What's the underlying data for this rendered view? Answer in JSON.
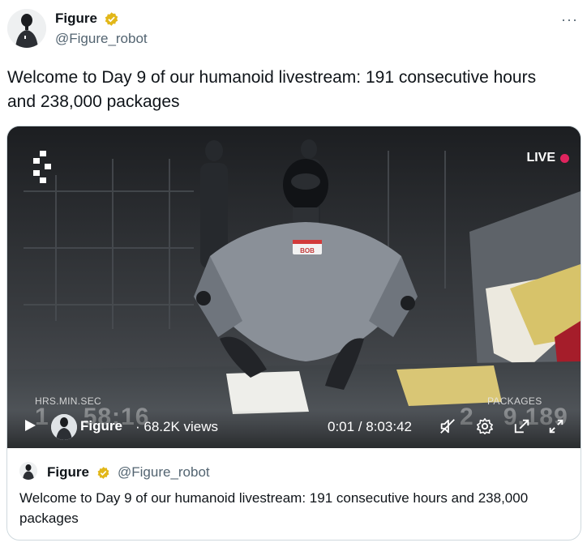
{
  "author": {
    "name": "Figure",
    "handle": "@Figure_robot",
    "verified_badge_color": "#e2b719"
  },
  "more_menu_label": "···",
  "tweet": {
    "text": "Welcome to Day 9 of our humanoid livestream: 191 consecutive hours and 238,000 packages"
  },
  "video": {
    "live_label": "LIVE",
    "live_color": "#e0245e",
    "hud_left_label": "HRS.MIN.SEC",
    "hud_left_value": "1",
    "hud_left_value_2": "58:16",
    "hud_right_label": "PACKAGES",
    "hud_right_value": "2",
    "hud_right_value_2": "9,189",
    "badge_name": "BOB",
    "channel_name": "Figure",
    "views": "· 68.2K views",
    "time": "0:01 / 8:03:42",
    "icons": [
      "play-icon",
      "mute-icon",
      "settings-icon",
      "pip-icon",
      "fullscreen-icon"
    ]
  },
  "quote": {
    "name": "Figure",
    "handle": "@Figure_robot",
    "text": "Welcome to Day 9 of our humanoid livestream: 191 consecutive hours and 238,000 packages"
  }
}
